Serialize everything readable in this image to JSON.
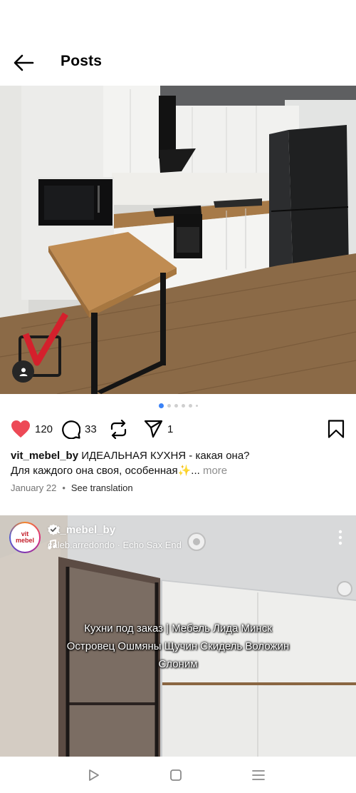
{
  "header": {
    "title": "Posts"
  },
  "post1": {
    "carousel": {
      "count": 6,
      "active": 0
    },
    "likes": "120",
    "comments": "33",
    "shares": "1",
    "username": "vit_mebel_by",
    "caption_line1": "ИДЕАЛЬНАЯ КУХНЯ - какая она?",
    "caption_line2": "Для каждого она своя, особенная✨...",
    "more_label": "more",
    "date": "January 22",
    "separator": "•",
    "translate_label": "See translation"
  },
  "post2": {
    "username": "vit_mebel_by",
    "avatar_text": "vit mebel",
    "audio": "caleb.arredondo · Echo Sax End",
    "overlay_line1": "Кухни под заказ | Мебель Лида Минск",
    "overlay_line2": "Островец Ошмяны Щучин Скидель Воложин",
    "overlay_line3": "Слоним"
  },
  "colors": {
    "like": "#ed4956",
    "active_dot": "#3b82f6",
    "accent": "#000000"
  },
  "icons": [
    "back-arrow-icon",
    "heart-icon",
    "comment-icon",
    "repost-icon",
    "share-icon",
    "bookmark-icon",
    "verified-icon",
    "music-note-icon",
    "more-dots-icon",
    "nav-back-icon",
    "nav-home-icon",
    "nav-menu-icon",
    "user-tag-icon"
  ]
}
